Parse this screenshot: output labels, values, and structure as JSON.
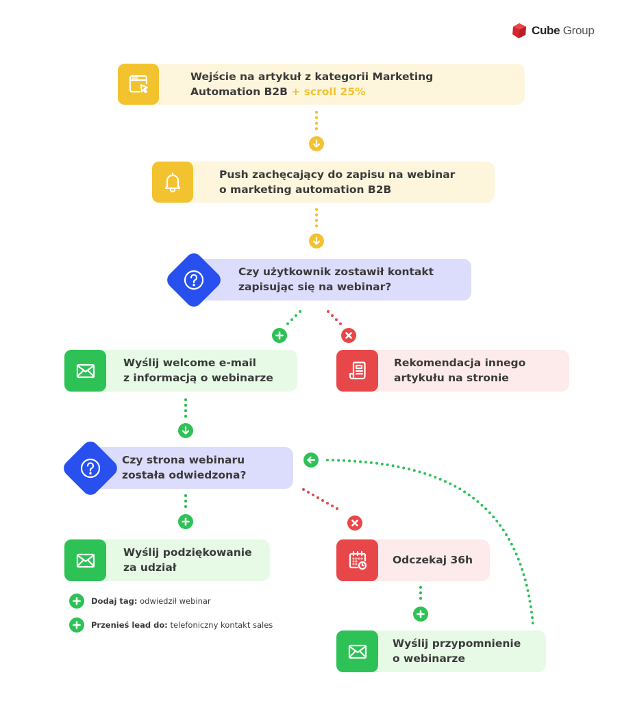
{
  "logo": {
    "brand_bold": "Cube",
    "brand_light": " Group",
    "icon": "cube-logo-icon"
  },
  "colors": {
    "yellow": "#f3c22f",
    "yellow_bg": "#fdf6dc",
    "blue": "#2850ee",
    "blue_bg": "#dcdcfc",
    "green": "#2ec256",
    "green_bg": "#e6fae6",
    "red": "#e8474a",
    "red_bg": "#fdeaea"
  },
  "steps": {
    "entry": {
      "icon": "browser-click-icon",
      "line1": "Wejście na artykuł z kategorii Marketing",
      "line2_main": "Automation B2B ",
      "line2_highlight": "+ scroll 25%"
    },
    "push": {
      "icon": "bell-icon",
      "line1": "Push zachęcający do zapisu na webinar",
      "line2": "o marketing automation B2B"
    },
    "question1": {
      "icon": "question-icon",
      "line1": "Czy użytkownik zostawił kontakt",
      "line2": "zapisując się na webinar?"
    },
    "welcome_email": {
      "icon": "envelope-icon",
      "line1": "Wyślij welcome e-mail",
      "line2": "z informacją o webinarze"
    },
    "recommendation": {
      "icon": "article-icon",
      "line1": "Rekomendacja innego",
      "line2": "artykułu na stronie"
    },
    "question2": {
      "icon": "question-icon",
      "line1": "Czy strona webinaru",
      "line2": "została odwiedzona?"
    },
    "thanks": {
      "icon": "envelope-icon",
      "line1": "Wyślij podziękowanie",
      "line2": "za udział"
    },
    "wait": {
      "icon": "calendar-clock-icon",
      "line1": "Odczekaj 36h"
    },
    "reminder": {
      "icon": "envelope-icon",
      "line1": "Wyślij przypomnienie",
      "line2": "o webinarze"
    }
  },
  "actions": [
    {
      "bold": "Dodaj tag:",
      "text": " odwiedził webinar"
    },
    {
      "bold": "Przenieś lead do:",
      "text": " telefoniczny kontakt sales"
    }
  ],
  "connectors": {
    "yes_label": "plus-icon",
    "no_label": "cross-icon",
    "down_label": "arrow-down-icon",
    "back_label": "arrow-left-icon"
  }
}
